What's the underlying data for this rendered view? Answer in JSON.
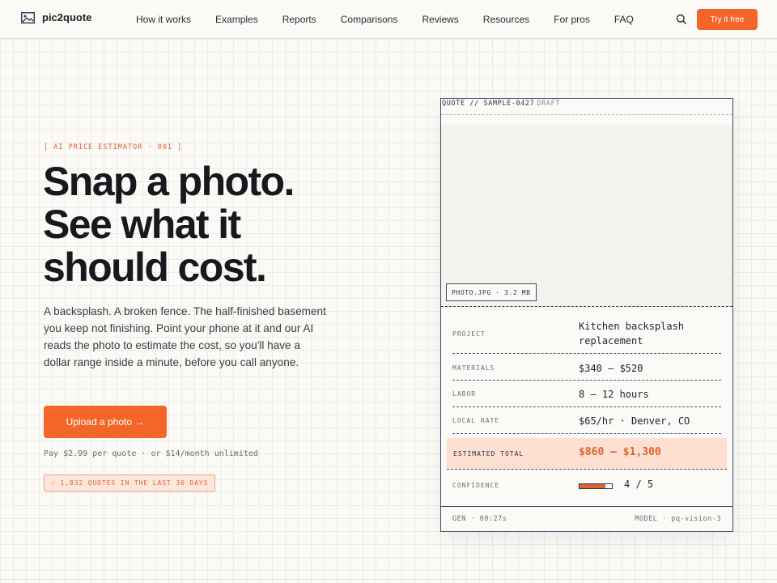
{
  "nav": {
    "brand": "pic2quote",
    "logo_icon": "image-icon",
    "links": [
      "How it works",
      "Examples",
      "Reports",
      "Comparisons",
      "Reviews",
      "Resources",
      "For pros",
      "FAQ"
    ],
    "search_icon": "search-icon",
    "cta_label": "Try it free"
  },
  "hero": {
    "kicker": "[ AI PRICE ESTIMATOR · 001 ]",
    "headline": [
      "Snap a photo.",
      "See what it",
      "should cost."
    ],
    "lede": "A backsplash. A broken fence. The half-finished basement you keep not finishing. Point your phone at it and our AI reads the photo to estimate the cost, so you'll have a dollar range inside a minute, before you call anyone.",
    "upload_label": "Upload a photo →",
    "pricing_note": "Pay $2.99 per quote · or $14/month unlimited",
    "quotes_badge": "✓ 1,832 QUOTES IN THE LAST 30 DAYS"
  },
  "quote_card": {
    "title": "QUOTE // SAMPLE-0427",
    "status": "DRAFT",
    "photo_tag": "PHOTO.JPG · 3.2 MB",
    "rows": [
      {
        "label": "PROJECT",
        "value": "Kitchen backsplash replacement"
      },
      {
        "label": "MATERIALS",
        "value": "$340 – $520"
      },
      {
        "label": "LABOR",
        "value": "8 – 12 hours"
      },
      {
        "label": "LOCAL RATE",
        "value": "$65/hr · Denver, CO"
      }
    ],
    "total_label": "ESTIMATED TOTAL",
    "total_value": "$860 – $1,300",
    "confidence_label": "CONFIDENCE",
    "confidence_text": "4 / 5",
    "confidence_level": 0.8,
    "footer_left": "GEN · 00:27s",
    "footer_right": "MODEL · pq-vision-3"
  },
  "colors": {
    "accent": "#f4652a",
    "ink": "#17191e",
    "card_border": "#3b4b6b",
    "total_band": "#fde0cf"
  }
}
